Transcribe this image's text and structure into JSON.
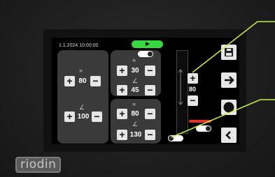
{
  "status": {
    "datetime": "1.1.2024 10:00:00"
  },
  "left_panel": {
    "top_value": "80",
    "bottom_value": "100"
  },
  "middle_panel": {
    "upper": {
      "value_1": "30",
      "value_2": "45"
    },
    "lower": {
      "value_1": "80",
      "value_2": "130"
    }
  },
  "vertical_control": {
    "value": "80"
  },
  "brand": {
    "logo_text": "riodin"
  },
  "colors": {
    "accent": "#c6f04a",
    "play": "#35d840",
    "alert": "#e0362c"
  }
}
